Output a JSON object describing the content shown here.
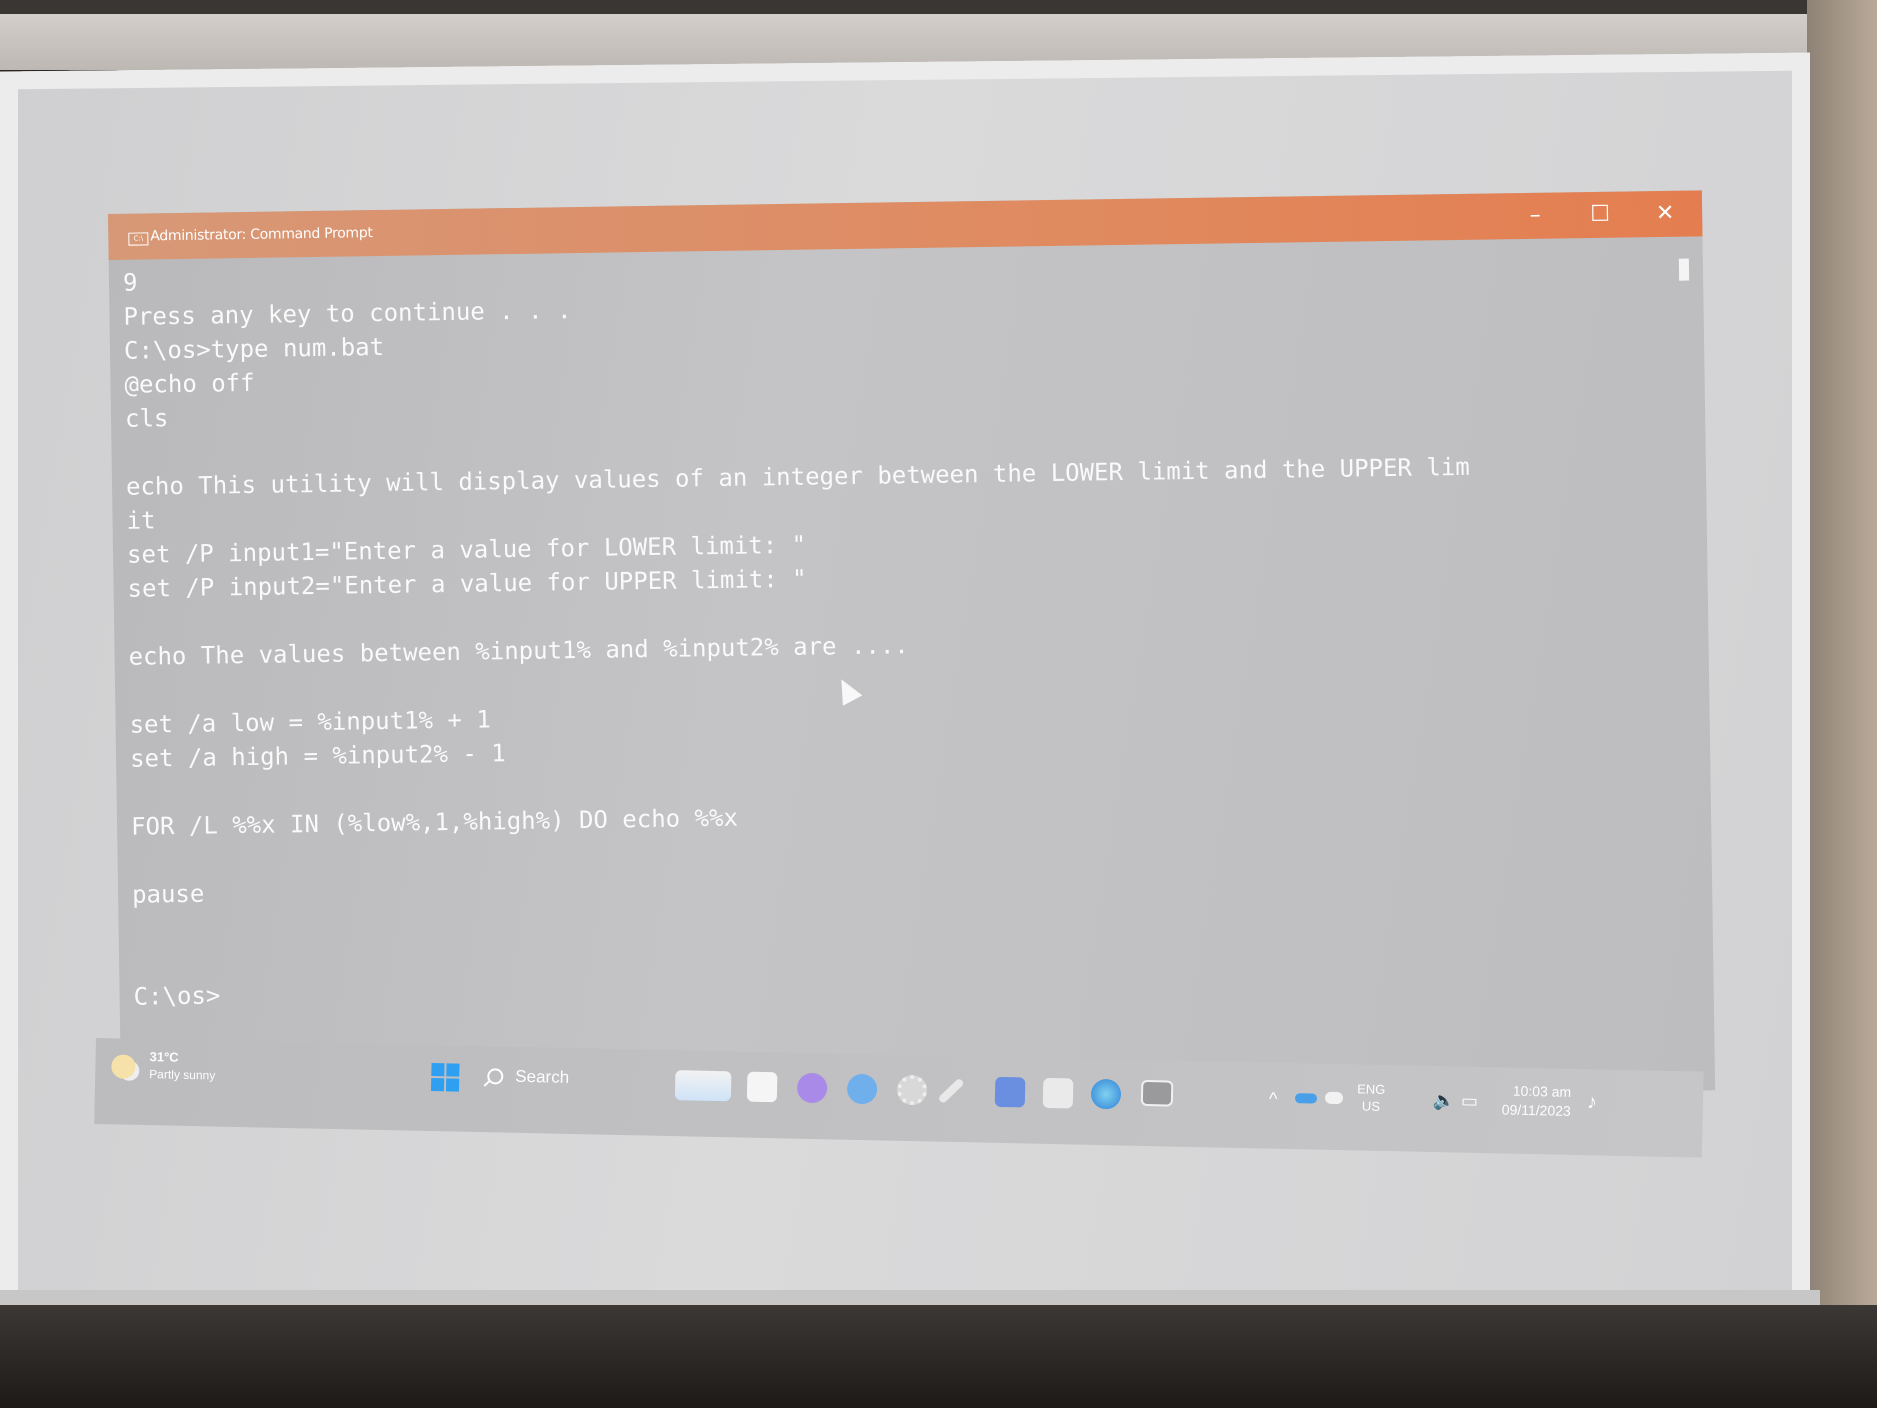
{
  "window": {
    "title": "Administrator: Command Prompt",
    "controls": {
      "minimize": "–",
      "maximize": "☐",
      "close": "✕"
    }
  },
  "console": {
    "lines": [
      "9",
      "Press any key to continue . . .",
      "C:\\os>type num.bat",
      "@echo off",
      "cls",
      "",
      "echo This utility will display values of an integer between the LOWER limit and the UPPER lim",
      "it",
      "set /P input1=\"Enter a value for LOWER limit: \"",
      "set /P input2=\"Enter a value for UPPER limit: \"",
      "",
      "echo The values between %input1% and %input2% are ....",
      "",
      "set /a low = %input1% + 1",
      "set /a high = %input2% - 1",
      "",
      "FOR /L %%x IN (%low%,1,%high%) DO echo %%x",
      "",
      "pause",
      "",
      "",
      "C:\\os>"
    ]
  },
  "taskbar": {
    "weather": {
      "temp": "31°C",
      "desc": "Partly sunny"
    },
    "search_label": "Search",
    "icons": [
      "file-explorer-icon",
      "calendar-icon",
      "messenger-icon",
      "browser-icon",
      "settings-icon",
      "pen-icon",
      "teams-icon",
      "remote-icon",
      "edge-icon",
      "terminal-icon"
    ],
    "language": {
      "lang": "ENG",
      "region": "US"
    },
    "clock": {
      "time": "10:03 am",
      "date": "09/11/2023"
    }
  },
  "colors": {
    "titlebar": "#e08a60",
    "console_text": "#fafafa",
    "start_blue": "#2f9ff2"
  }
}
